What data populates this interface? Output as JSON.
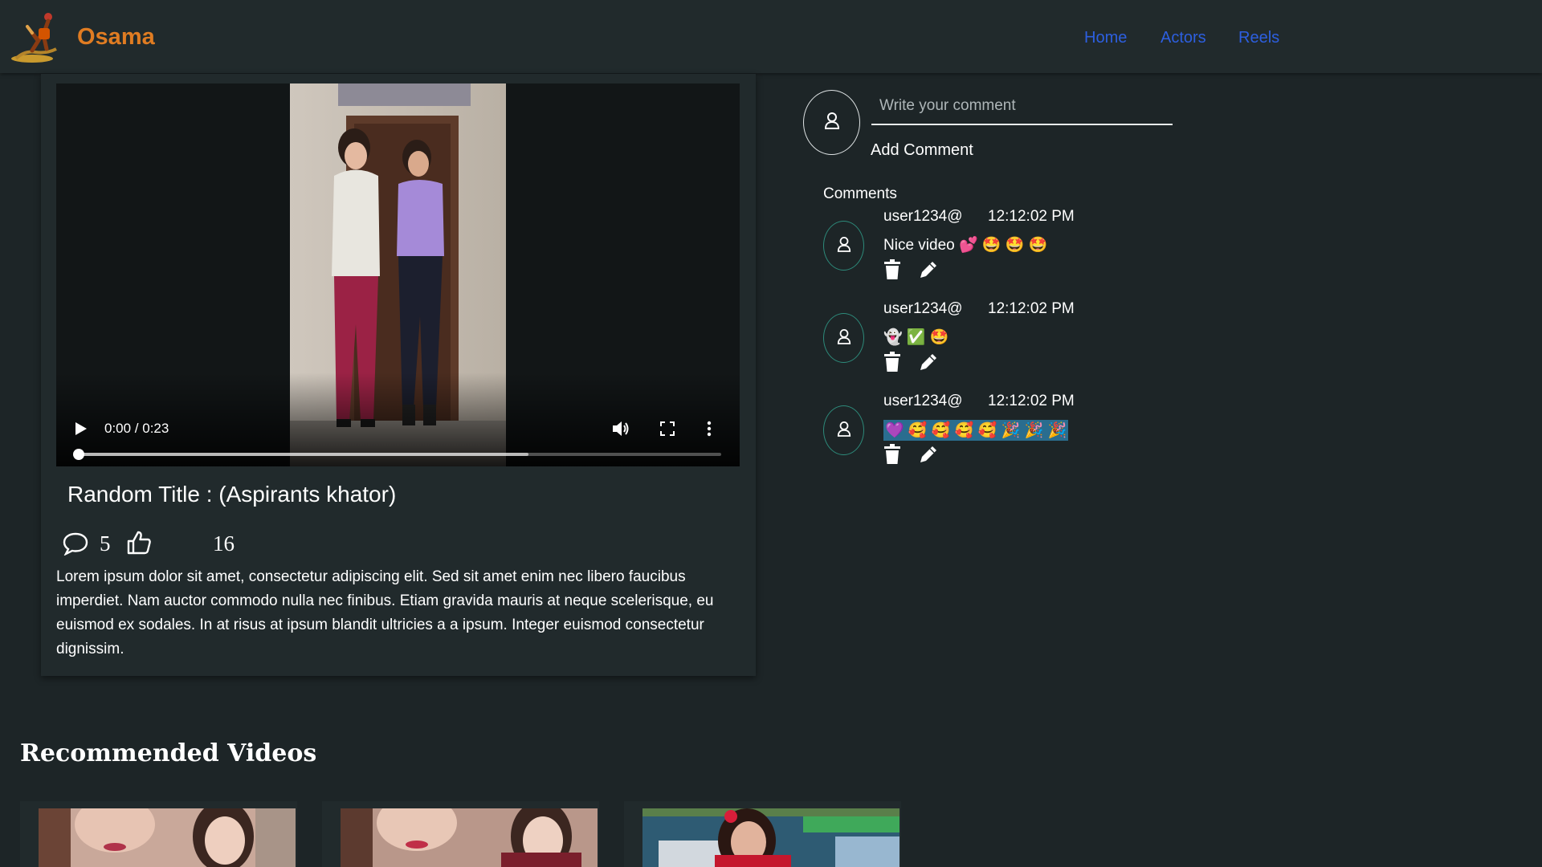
{
  "header": {
    "brand": "Osama",
    "nav": [
      {
        "label": "Home"
      },
      {
        "label": "Actors"
      },
      {
        "label": "Reels"
      }
    ],
    "link_color": "#2d5fe0",
    "brand_color": "#e07c22"
  },
  "video": {
    "time_display": "0:00 / 0:23",
    "current_time": "0:00",
    "duration": "0:23",
    "played_fraction": 0,
    "buffered_fraction": 0.7,
    "title": "Random Title : (Aspirants khator)",
    "comments_count": "5",
    "likes_count": "16",
    "description": "Lorem ipsum dolor sit amet, consectetur adipiscing elit. Sed sit amet enim nec libero faucibus imperdiet. Nam auctor commodo nulla nec finibus. Etiam gravida mauris at neque scelerisque, eu euismod ex sodales. In at risus at ipsum blandit ultricies a a ipsum. Integer euismod consectetur dignissim."
  },
  "comment_form": {
    "placeholder": "Write your comment",
    "value": "",
    "submit_label": "Add Comment"
  },
  "comments": {
    "heading": "Comments",
    "items": [
      {
        "user": "user1234@",
        "time": "12:12:02 PM",
        "text": "Nice video 💕 🤩 🤩 🤩"
      },
      {
        "user": "user1234@",
        "time": "12:12:02 PM",
        "text": "👻 ✅ 🤩"
      },
      {
        "user": "user1234@",
        "time": "12:12:02 PM",
        "text": "💜 🥰 🥰 🥰 🥰 🎉 🎉 🎉"
      }
    ]
  },
  "recommended": {
    "heading": "Recommended Videos"
  },
  "icons": {
    "play": "play-icon",
    "volume": "volume-icon",
    "fullscreen": "fullscreen-icon",
    "more": "more-vertical-icon",
    "comment": "speech-bubble-icon",
    "like": "thumbs-up-icon",
    "user": "user-icon",
    "delete": "trash-icon",
    "edit": "pencil-icon"
  }
}
